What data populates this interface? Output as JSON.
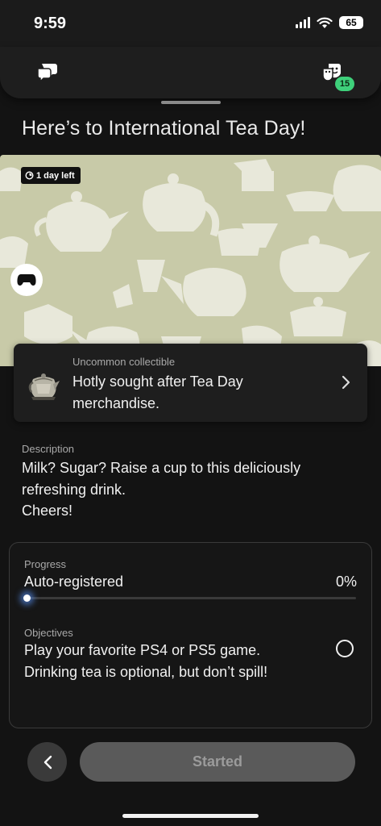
{
  "status_bar": {
    "time": "9:59",
    "battery": "65",
    "icons": [
      "cellular-signal-icon",
      "wifi-icon",
      "battery-icon"
    ]
  },
  "top_bar": {
    "left_icon": "chat-bubbles-icon",
    "right_icon": "friends-icon",
    "friends_badge": "15",
    "badge_color": "#3ed07a"
  },
  "page": {
    "title": "Here’s to International Tea Day!"
  },
  "banner": {
    "time_left": "1 day left",
    "time_icon": "timer-icon",
    "platform_icon": "controller-icon",
    "background_color": "#c8caa8",
    "pattern_color": "#ebebdf"
  },
  "collectible": {
    "rarity": "Uncommon collectible",
    "name": "Hotly sought after Tea Day merchandise.",
    "thumb_icon": "teapot-thumbnail",
    "arrow_icon": "chevron-right-icon"
  },
  "description": {
    "label": "Description",
    "lines": [
      "Milk? Sugar? Raise a cup to this deliciously",
      "refreshing drink.",
      "Cheers!"
    ]
  },
  "progress": {
    "label": "Progress",
    "status": "Auto-registered",
    "percent_text": "0%",
    "value": 0
  },
  "objectives": {
    "label": "Objectives",
    "text": "Play your favorite PS4 or PS5 game. Drinking tea is optional, but don’t spill!",
    "check_icon": "empty-circle-icon"
  },
  "footer": {
    "back_icon": "chevron-left-icon",
    "button_label": "Started"
  }
}
